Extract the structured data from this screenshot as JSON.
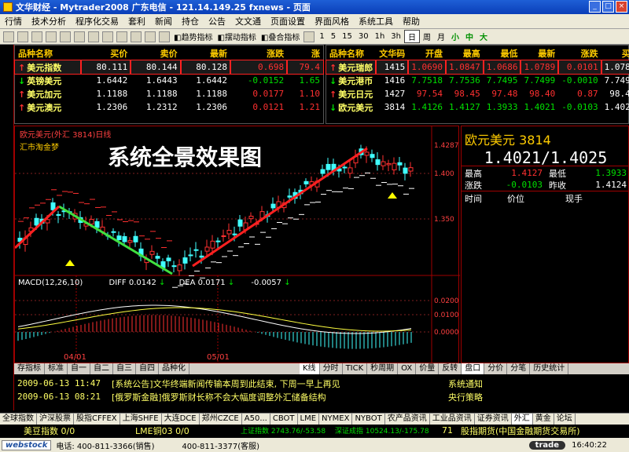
{
  "window": {
    "title": "文华财经 - Mytrader2008    广东电信 - 121.14.149.25    fxnews - 页面"
  },
  "menu": [
    "行情",
    "技术分析",
    "程序化交易",
    "套利",
    "新闻",
    "持仓",
    "公告",
    "文文通",
    "页面设置",
    "界面风格",
    "系统工具",
    "帮助"
  ],
  "toolbar": {
    "buttons": [
      "趋势指标",
      "摆动指标",
      "叠合指标"
    ],
    "periods": [
      "1",
      "5",
      "15",
      "30",
      "1h",
      "3h",
      "日",
      "周",
      "月"
    ],
    "selected_period": "日",
    "sizes": [
      "小",
      "中",
      "大"
    ]
  },
  "left_quotes": {
    "headers": [
      "品种名称",
      "买价",
      "卖价",
      "最新",
      "涨跌"
    ],
    "partial_header": "涨",
    "rows": [
      {
        "dir": "up",
        "name": "美元指数",
        "bid": "80.111",
        "ask": "80.144",
        "last": "80.128",
        "chg": "0.698",
        "extra": "79.4"
      },
      {
        "dir": "down",
        "name": "英镑美元",
        "bid": "1.6442",
        "ask": "1.6443",
        "last": "1.6442",
        "chg": "-0.0152",
        "extra": "1.65"
      },
      {
        "dir": "up",
        "name": "美元加元",
        "bid": "1.1188",
        "ask": "1.1188",
        "last": "1.1188",
        "chg": "0.0177",
        "extra": "1.10"
      },
      {
        "dir": "up",
        "name": "美元澳元",
        "bid": "1.2306",
        "ask": "1.2312",
        "last": "1.2306",
        "chg": "0.0121",
        "extra": "1.21"
      }
    ]
  },
  "right_quotes": {
    "headers": [
      "品种名称",
      "文华码",
      "开盘",
      "最高",
      "最低",
      "最新",
      "涨跌"
    ],
    "partial_header": "买",
    "rows": [
      {
        "dir": "up",
        "name": "美元瑞郎",
        "code": "1415",
        "open": "1.0690",
        "high": "1.0847",
        "low": "1.0686",
        "last": "1.0789",
        "chg": "0.0101",
        "extra": "1.078"
      },
      {
        "dir": "down",
        "name": "美元港币",
        "code": "1416",
        "open": "7.7518",
        "high": "7.7536",
        "low": "7.7495",
        "last": "7.7499",
        "chg": "-0.0010",
        "extra": "7.749"
      },
      {
        "dir": "up",
        "name": "美元日元",
        "code": "1427",
        "open": "97.54",
        "high": "98.45",
        "low": "97.48",
        "last": "98.40",
        "chg": "0.87",
        "extra": "98.4"
      },
      {
        "dir": "down",
        "name": "欧元美元",
        "code": "3814",
        "open": "1.4126",
        "high": "1.4127",
        "low": "1.3933",
        "last": "1.4021",
        "chg": "-0.0103",
        "extra": "1.402"
      }
    ]
  },
  "chart": {
    "header": "欧元美元(外汇 3814)日线",
    "source": "汇市淘金梦",
    "overlay_title": "系统全景效果图",
    "price_labels": [
      "1.4287",
      "1.400",
      "1.350"
    ],
    "macd": {
      "label": "MACD(12,26,10)",
      "diff_label": "DIFF",
      "diff": "0.0142",
      "dea_label": "DEA",
      "dea": "0.0171",
      "macd_val": "-0.0057",
      "axis": [
        "0.0200",
        "0.0100",
        "0.0000"
      ]
    },
    "dates": [
      "04/01",
      "05/01"
    ]
  },
  "side_panel": {
    "title": "欧元美元  3814",
    "price": "1.4021/1.4025",
    "stats": [
      {
        "k1": "最高",
        "v1": "1.4127",
        "k2": "最低",
        "v2": "1.3933"
      },
      {
        "k1": "涨跌",
        "v1": "-0.0103",
        "k2": "昨收",
        "v2": "1.4124"
      }
    ],
    "cols": [
      "时间",
      "价位",
      "现手"
    ]
  },
  "chart_tabs": [
    "存指标",
    "标准",
    "自一",
    "自二",
    "自三",
    "自四",
    "品种化",
    "K线",
    "分时",
    "TICK",
    "秒周期",
    "OX",
    "价量",
    "反转",
    "盘口",
    "分价",
    "分笔",
    "历史统计"
  ],
  "news": [
    {
      "time": "2009-06-13 11:47",
      "headline": "[系统公告]文华终端新闻传输本周到此结束, 下周一早上再见",
      "source": "系统通知"
    },
    {
      "time": "2009-06-13 08:21",
      "headline": "[俄罗斯金融]俄罗斯财长称不会大幅度调整外汇储备结构",
      "source": "央行策略"
    }
  ],
  "market_tabs": [
    "全球指数",
    "沪深股票",
    "股指CFFEX",
    "上海SHFE",
    "大连DCE",
    "郑州CZCE",
    "A50...",
    "CBOT",
    "LME",
    "NYMEX",
    "NYBOT",
    "农产品资讯",
    "工业品资讯",
    "证券资讯",
    "外汇",
    "黄金",
    "论坛"
  ],
  "selected_market_tab": "外汇",
  "ticker": {
    "left": "美豆指数  0/0",
    "mid": "LME铜03  0/0",
    "idx1": "上证指数  2743.76/-53.58",
    "idx2": "深证成指  10524.13/-175.78",
    "num": "71",
    "right": "股指期货(中国金融期货交易所)"
  },
  "status": {
    "logo": "webstock",
    "phone1": "电话: 400-811-3366(销售)",
    "phone2": "400-811-3377(客服)",
    "trade": "trade",
    "time": "16:40:22"
  },
  "colors": {
    "up": "#ff3030",
    "down": "#00e000",
    "title_yellow": "#ffcc00",
    "trend_up": "#ff2020",
    "trend_down": "#40e040"
  }
}
